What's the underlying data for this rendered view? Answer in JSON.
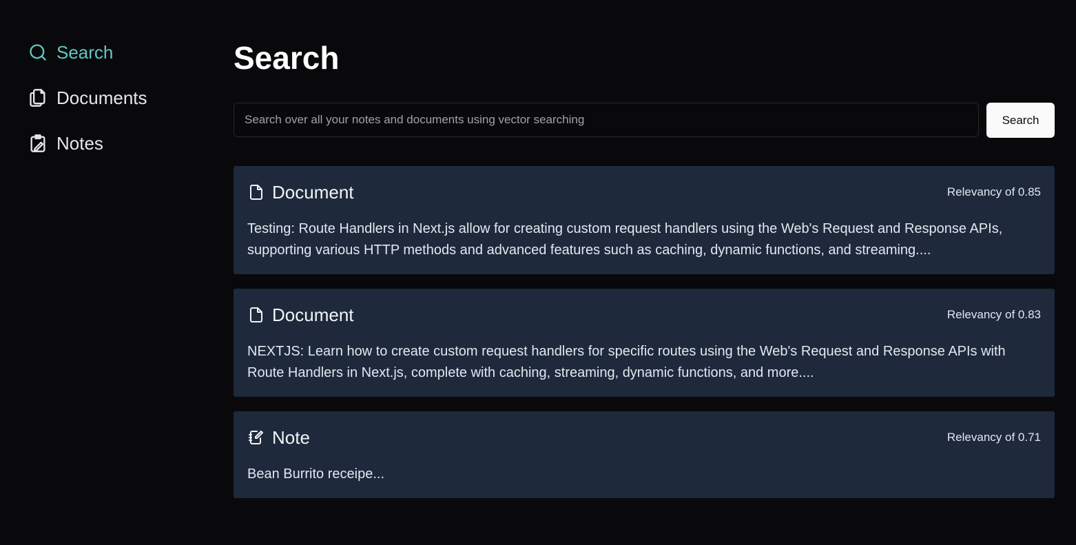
{
  "sidebar": {
    "items": [
      {
        "label": "Search",
        "icon": "search-icon",
        "active": true
      },
      {
        "label": "Documents",
        "icon": "documents-icon",
        "active": false
      },
      {
        "label": "Notes",
        "icon": "notes-icon",
        "active": false
      }
    ]
  },
  "main": {
    "title": "Search",
    "search": {
      "placeholder": "Search over all your notes and documents using vector searching",
      "value": "",
      "button_label": "Search"
    },
    "results": [
      {
        "type": "Document",
        "icon": "file-icon",
        "relevancy": "Relevancy of 0.85",
        "snippet": "Testing: Route Handlers in Next.js allow for creating custom request handlers using the Web's Request and Response APIs, supporting various HTTP methods and advanced features such as caching, dynamic functions, and streaming...."
      },
      {
        "type": "Document",
        "icon": "file-icon",
        "relevancy": "Relevancy of 0.83",
        "snippet": "NEXTJS: Learn how to create custom request handlers for specific routes using the Web's Request and Response APIs with Route Handlers in Next.js, complete with caching, streaming, dynamic functions, and more...."
      },
      {
        "type": "Note",
        "icon": "note-edit-icon",
        "relevancy": "Relevancy of 0.71",
        "snippet": "Bean Burrito receipe..."
      }
    ]
  },
  "colors": {
    "background": "#09090b",
    "accent": "#5fc8c0",
    "card": "#1e293b",
    "button_bg": "#fafafa"
  }
}
